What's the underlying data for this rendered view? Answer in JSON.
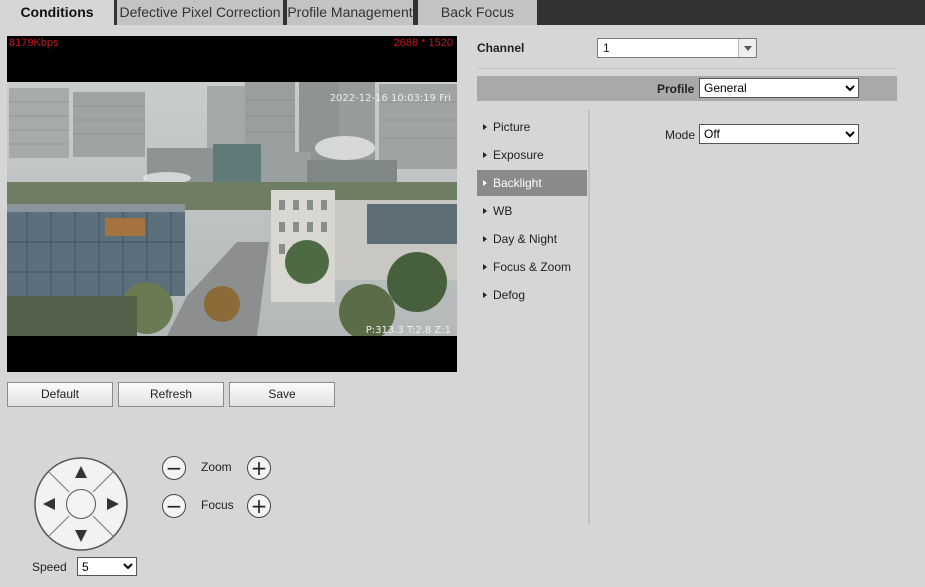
{
  "tabs": [
    {
      "label": "Conditions",
      "active": true
    },
    {
      "label": "Defective Pixel Correction",
      "active": false
    },
    {
      "label": "Profile Management",
      "active": false
    },
    {
      "label": "Back Focus",
      "active": false
    }
  ],
  "video": {
    "bitrate": "8179Kbps",
    "resolution": "2688 * 1520",
    "timestamp": "2022-12-16 10:03:19 Fri",
    "ptz_status": "P:313.3 T:2.8 Z:1"
  },
  "buttons": {
    "default": "Default",
    "refresh": "Refresh",
    "save": "Save"
  },
  "ptz": {
    "zoom_label": "Zoom",
    "focus_label": "Focus",
    "minus_glyph": "−",
    "plus_glyph": "+",
    "speed_label": "Speed",
    "speed_value": "5"
  },
  "settings": {
    "channel_label": "Channel",
    "channel_value": "1",
    "profile_label": "Profile",
    "profile_value": "General",
    "mode_label": "Mode",
    "mode_value": "Off",
    "menu": [
      {
        "label": "Picture",
        "active": false
      },
      {
        "label": "Exposure",
        "active": false
      },
      {
        "label": "Backlight",
        "active": true
      },
      {
        "label": "WB",
        "active": false
      },
      {
        "label": "Day & Night",
        "active": false
      },
      {
        "label": "Focus & Zoom",
        "active": false
      },
      {
        "label": "Defog",
        "active": false
      }
    ]
  },
  "colors": {
    "background": "#d6d6d6",
    "tabbar": "#323232",
    "overlay_red": "#c01818",
    "menu_active": "#8a8a8a",
    "profile_bar": "#a9a9a9"
  },
  "icons": [
    "arrow-up-icon",
    "arrow-down-icon",
    "arrow-left-icon",
    "arrow-right-icon",
    "zoom-out-icon",
    "zoom-in-icon",
    "focus-minus-icon",
    "focus-plus-icon",
    "dropdown-arrow-icon"
  ]
}
